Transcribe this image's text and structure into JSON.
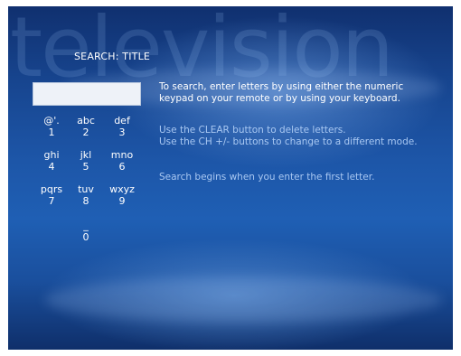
{
  "watermark": "television",
  "page_title": "SEARCH: TITLE",
  "search": {
    "value": ""
  },
  "keypad": [
    {
      "letters": "@'.",
      "digit": "1"
    },
    {
      "letters": "abc",
      "digit": "2"
    },
    {
      "letters": "def",
      "digit": "3"
    },
    {
      "letters": "ghi",
      "digit": "4"
    },
    {
      "letters": "jkl",
      "digit": "5"
    },
    {
      "letters": "mno",
      "digit": "6"
    },
    {
      "letters": "pqrs",
      "digit": "7"
    },
    {
      "letters": "tuv",
      "digit": "8"
    },
    {
      "letters": "wxyz",
      "digit": "9"
    },
    {
      "letters": "_",
      "digit": "0"
    }
  ],
  "instructions": {
    "line1": "To search, enter letters by using either the numeric",
    "line2": "keypad on your remote or by using your keyboard.",
    "line3": "Use the CLEAR button to delete letters.",
    "line4": "Use the CH +/- buttons to change to a different mode.",
    "line5": "Search begins when you enter the first letter."
  }
}
